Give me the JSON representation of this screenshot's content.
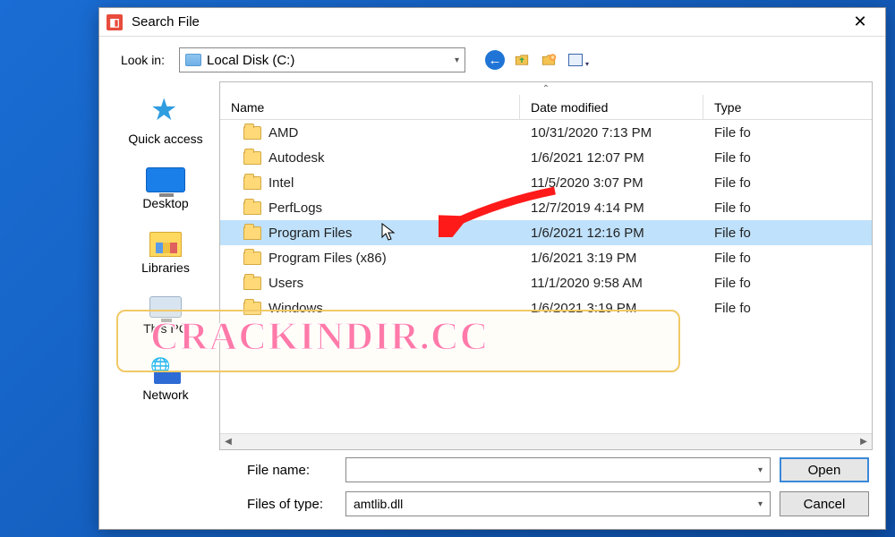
{
  "dialog": {
    "title": "Search File"
  },
  "lookin": {
    "label": "Look in:",
    "value": "Local Disk (C:)"
  },
  "columns": {
    "name": "Name",
    "date": "Date modified",
    "type": "Type"
  },
  "sidebar": {
    "items": [
      {
        "label": "Quick access",
        "icon": "star"
      },
      {
        "label": "Desktop",
        "icon": "desktop"
      },
      {
        "label": "Libraries",
        "icon": "libraries"
      },
      {
        "label": "This PC",
        "icon": "pc"
      },
      {
        "label": "Network",
        "icon": "network"
      }
    ]
  },
  "files": [
    {
      "name": "AMD",
      "date": "10/31/2020 7:13 PM",
      "type": "File fo",
      "selected": false
    },
    {
      "name": "Autodesk",
      "date": "1/6/2021 12:07 PM",
      "type": "File fo",
      "selected": false
    },
    {
      "name": "Intel",
      "date": "11/5/2020 3:07 PM",
      "type": "File fo",
      "selected": false
    },
    {
      "name": "PerfLogs",
      "date": "12/7/2019 4:14 PM",
      "type": "File fo",
      "selected": false
    },
    {
      "name": "Program Files",
      "date": "1/6/2021 12:16 PM",
      "type": "File fo",
      "selected": true
    },
    {
      "name": "Program Files (x86)",
      "date": "1/6/2021 3:19 PM",
      "type": "File fo",
      "selected": false
    },
    {
      "name": "Users",
      "date": "11/1/2020 9:58 AM",
      "type": "File fo",
      "selected": false
    },
    {
      "name": "Windows",
      "date": "1/6/2021 3:19 PM",
      "type": "File fo",
      "selected": false
    }
  ],
  "filename": {
    "label": "File name:",
    "value": ""
  },
  "filetype": {
    "label": "Files of type:",
    "value": "amtlib.dll"
  },
  "buttons": {
    "open": "Open",
    "cancel": "Cancel"
  },
  "watermark": "CRACKINDIR.CC"
}
